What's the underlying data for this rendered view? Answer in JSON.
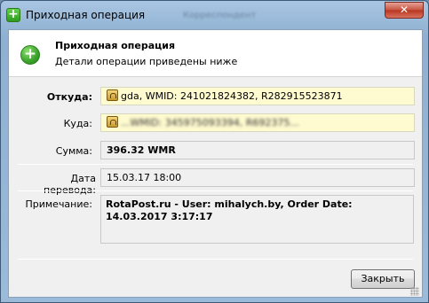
{
  "window": {
    "title": "Приходная операция",
    "ghost_title": "Корреспондент"
  },
  "header": {
    "title": "Приходная операция",
    "subtitle": "Детали операции приведены ниже"
  },
  "fields": {
    "from_label": "Откуда:",
    "from_value": "gda, WMID: 241021824382, R282915523871",
    "to_label": "Куда:",
    "to_value": "...WMID: 345975093394, R692375...",
    "amount_label": "Сумма:",
    "amount_value": "396.32 WMR",
    "date_label": "Дата перевода:",
    "date_value": "15.03.17 18:00",
    "note_label": "Примечание:",
    "note_value": "RotaPost.ru - User: mihalych.by, Order Date:\n14.03.2017 3:17:17"
  },
  "buttons": {
    "close_label": "Закрыть"
  },
  "colors": {
    "accent_green": "#3aa32a",
    "highlight_yellow": "#fffbd0",
    "titlebar_blue": "#9cbad9",
    "close_red": "#c7533f"
  },
  "icons": {
    "title": "green-plus-icon",
    "header": "green-plus-icon",
    "wallet": "webmoney-wallet-icon"
  }
}
